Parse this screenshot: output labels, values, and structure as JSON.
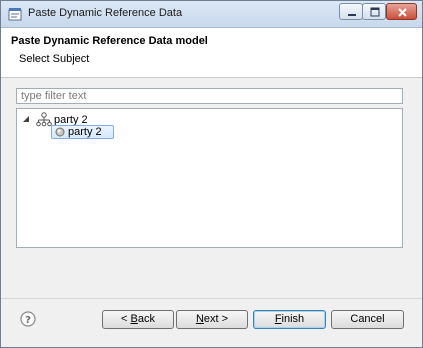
{
  "window": {
    "title": "Paste Dynamic Reference Data"
  },
  "header": {
    "title": "Paste Dynamic Reference Data model",
    "subtitle": "Select Subject"
  },
  "filter": {
    "value": "",
    "placeholder": "type filter text"
  },
  "tree": {
    "parent": {
      "label": "party 2",
      "icon": "hierarchy-icon",
      "expanded": true
    },
    "child": {
      "label": "party 2",
      "icon": "circle-node-icon",
      "selected": true
    }
  },
  "buttons": {
    "back": {
      "accel": "B",
      "rest": "ack",
      "prefix": "< "
    },
    "next": {
      "accel": "N",
      "rest": "ext >"
    },
    "finish": {
      "accel": "F",
      "rest": "inish"
    },
    "cancel": {
      "label": "Cancel"
    }
  },
  "colors": {
    "selection_border": "#84acdd",
    "selection_fill": "#d6e8fb",
    "default_button_border": "#3c7fb1"
  }
}
